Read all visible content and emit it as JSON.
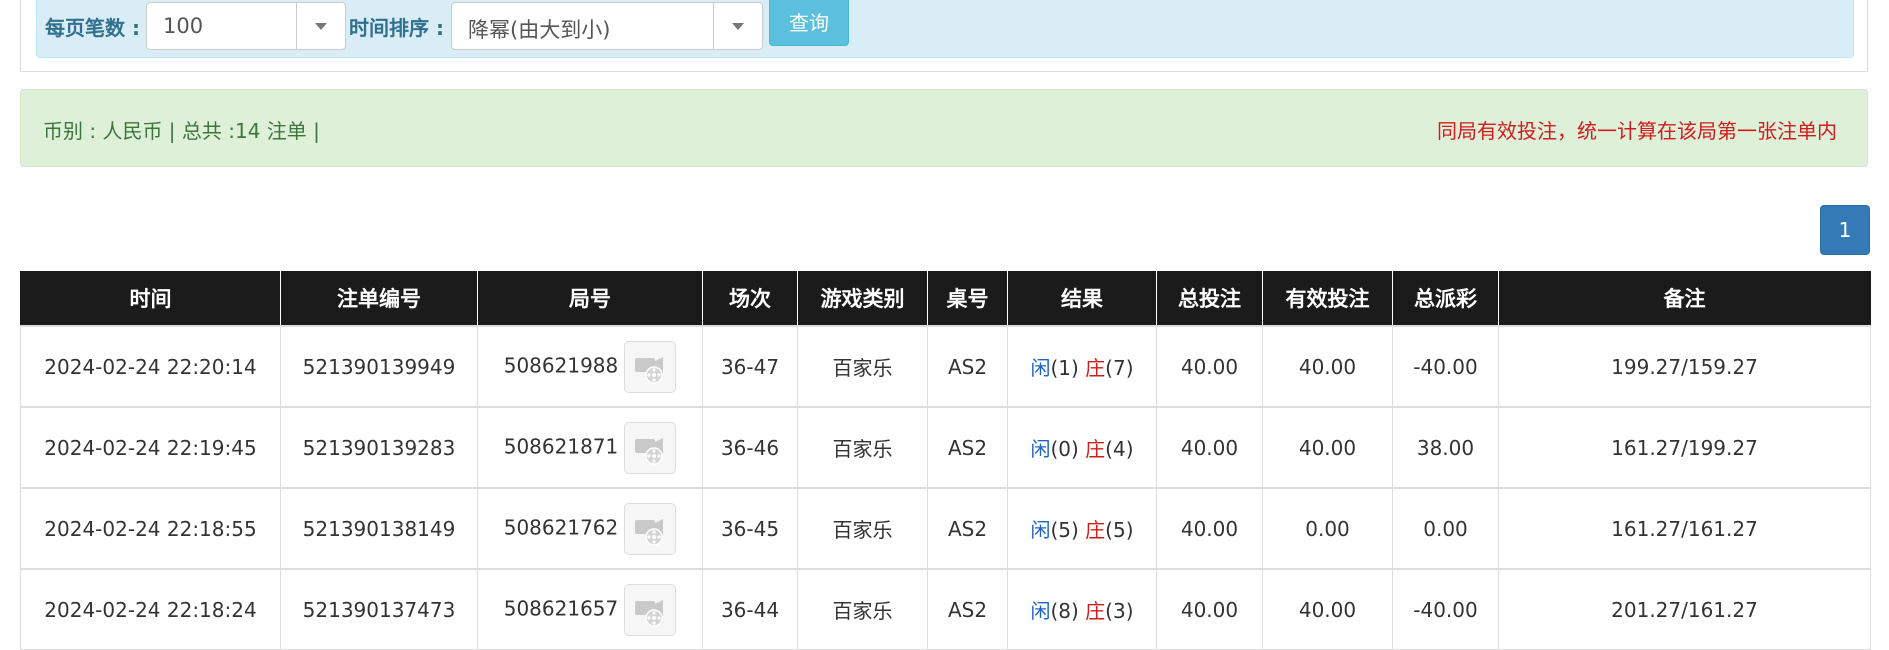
{
  "filters": {
    "page_size_label": "每页笔数 :",
    "page_size_value": "100",
    "sort_label": "时间排序 :",
    "sort_value": "降幂(由大到小)",
    "query_label": "查询"
  },
  "summary": {
    "left_text": "币别 : 人民币 | 总共 :14 注单 |",
    "right_text": "同局有效投注，统一计算在该局第一张注单内"
  },
  "pagination": {
    "current_page": "1"
  },
  "table": {
    "headers": [
      "时间",
      "注单编号",
      "局号",
      "场次",
      "游戏类别",
      "桌号",
      "结果",
      "总投注",
      "有效投注",
      "总派彩",
      "备注"
    ],
    "rows": [
      {
        "time": "2024-02-24 22:20:14",
        "bet_no": "521390139949",
        "round_no": "508621988",
        "shoe": "36-47",
        "game": "百家乐",
        "table": "AS2",
        "player_label": "闲",
        "player_value": "(1)",
        "banker_label": "庄",
        "banker_value": "(7)",
        "total_bet": "40.00",
        "valid_bet": "40.00",
        "payout": "-40.00",
        "remark": "199.27/159.27"
      },
      {
        "time": "2024-02-24 22:19:45",
        "bet_no": "521390139283",
        "round_no": "508621871",
        "shoe": "36-46",
        "game": "百家乐",
        "table": "AS2",
        "player_label": "闲",
        "player_value": "(0)",
        "banker_label": "庄",
        "banker_value": "(4)",
        "total_bet": "40.00",
        "valid_bet": "40.00",
        "payout": "38.00",
        "remark": "161.27/199.27"
      },
      {
        "time": "2024-02-24 22:18:55",
        "bet_no": "521390138149",
        "round_no": "508621762",
        "shoe": "36-45",
        "game": "百家乐",
        "table": "AS2",
        "player_label": "闲",
        "player_value": "(5)",
        "banker_label": "庄",
        "banker_value": "(5)",
        "total_bet": "40.00",
        "valid_bet": "0.00",
        "payout": "0.00",
        "remark": "161.27/161.27"
      },
      {
        "time": "2024-02-24 22:18:24",
        "bet_no": "521390137473",
        "round_no": "508621657",
        "shoe": "36-44",
        "game": "百家乐",
        "table": "AS2",
        "player_label": "闲",
        "player_value": "(8)",
        "banker_label": "庄",
        "banker_value": "(3)",
        "total_bet": "40.00",
        "valid_bet": "40.00",
        "payout": "-40.00",
        "remark": "201.27/161.27"
      }
    ]
  },
  "icons": {
    "replay": "video-replay-icon"
  },
  "colors": {
    "header_bg": "#1b1b1b",
    "positive_blue": "#1d63c9",
    "negative_red": "#d01c1c",
    "filter_bg": "#d9edf7",
    "summary_bg": "#dff0d8"
  }
}
